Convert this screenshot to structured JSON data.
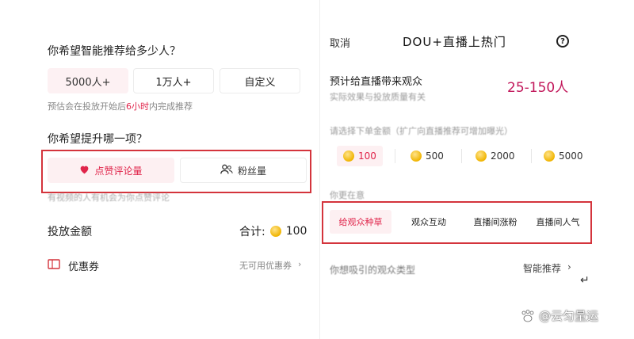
{
  "left": {
    "audience_question": "你希望智能推荐给多少人？",
    "audience_options": [
      "5000人+",
      "1万人+",
      "自定义"
    ],
    "hint_prefix": "预估会在投放开始后",
    "hint_highlight": "6小时",
    "hint_suffix": "内完成推荐",
    "goal_question": "你希望提升哪一项？",
    "goal_options": [
      "点赞评论量",
      "粉丝量"
    ],
    "goal_hint": "有视频的人有机会为你点赞评论",
    "amount_label": "投放金额",
    "total_label": "合计:",
    "total_value": "100",
    "coupon_label": "优惠券",
    "coupon_status": "无可用优惠券",
    "coupon_chevron": "›"
  },
  "right": {
    "cancel_label": "取消",
    "title": "DOU+直播上热门",
    "help_symbol": "?",
    "estimate_label": "预计给直播带来观众",
    "estimate_sub": "实际效果与投放质量有关",
    "estimate_range": "25-150人",
    "amount_label": "请选择下单金额（扩广向直播推荐可增加曝光）",
    "amount_options": [
      "100",
      "500",
      "2000",
      "5000"
    ],
    "goal_label": "你更在意",
    "goal_tabs": [
      "给观众种草",
      "观众互动",
      "直播间涨粉",
      "直播间人气"
    ],
    "audience_label": "你想吸引的观众类型",
    "audience_value": "智能推荐",
    "audience_chevron": "›",
    "return_symbol": "↵"
  },
  "watermark": {
    "text": "@云匀量运"
  },
  "colors": {
    "accent": "#e0244a",
    "highlight_box": "#d4343c",
    "selected_bg": "#fdf0f2",
    "coin": "#f0b400"
  }
}
